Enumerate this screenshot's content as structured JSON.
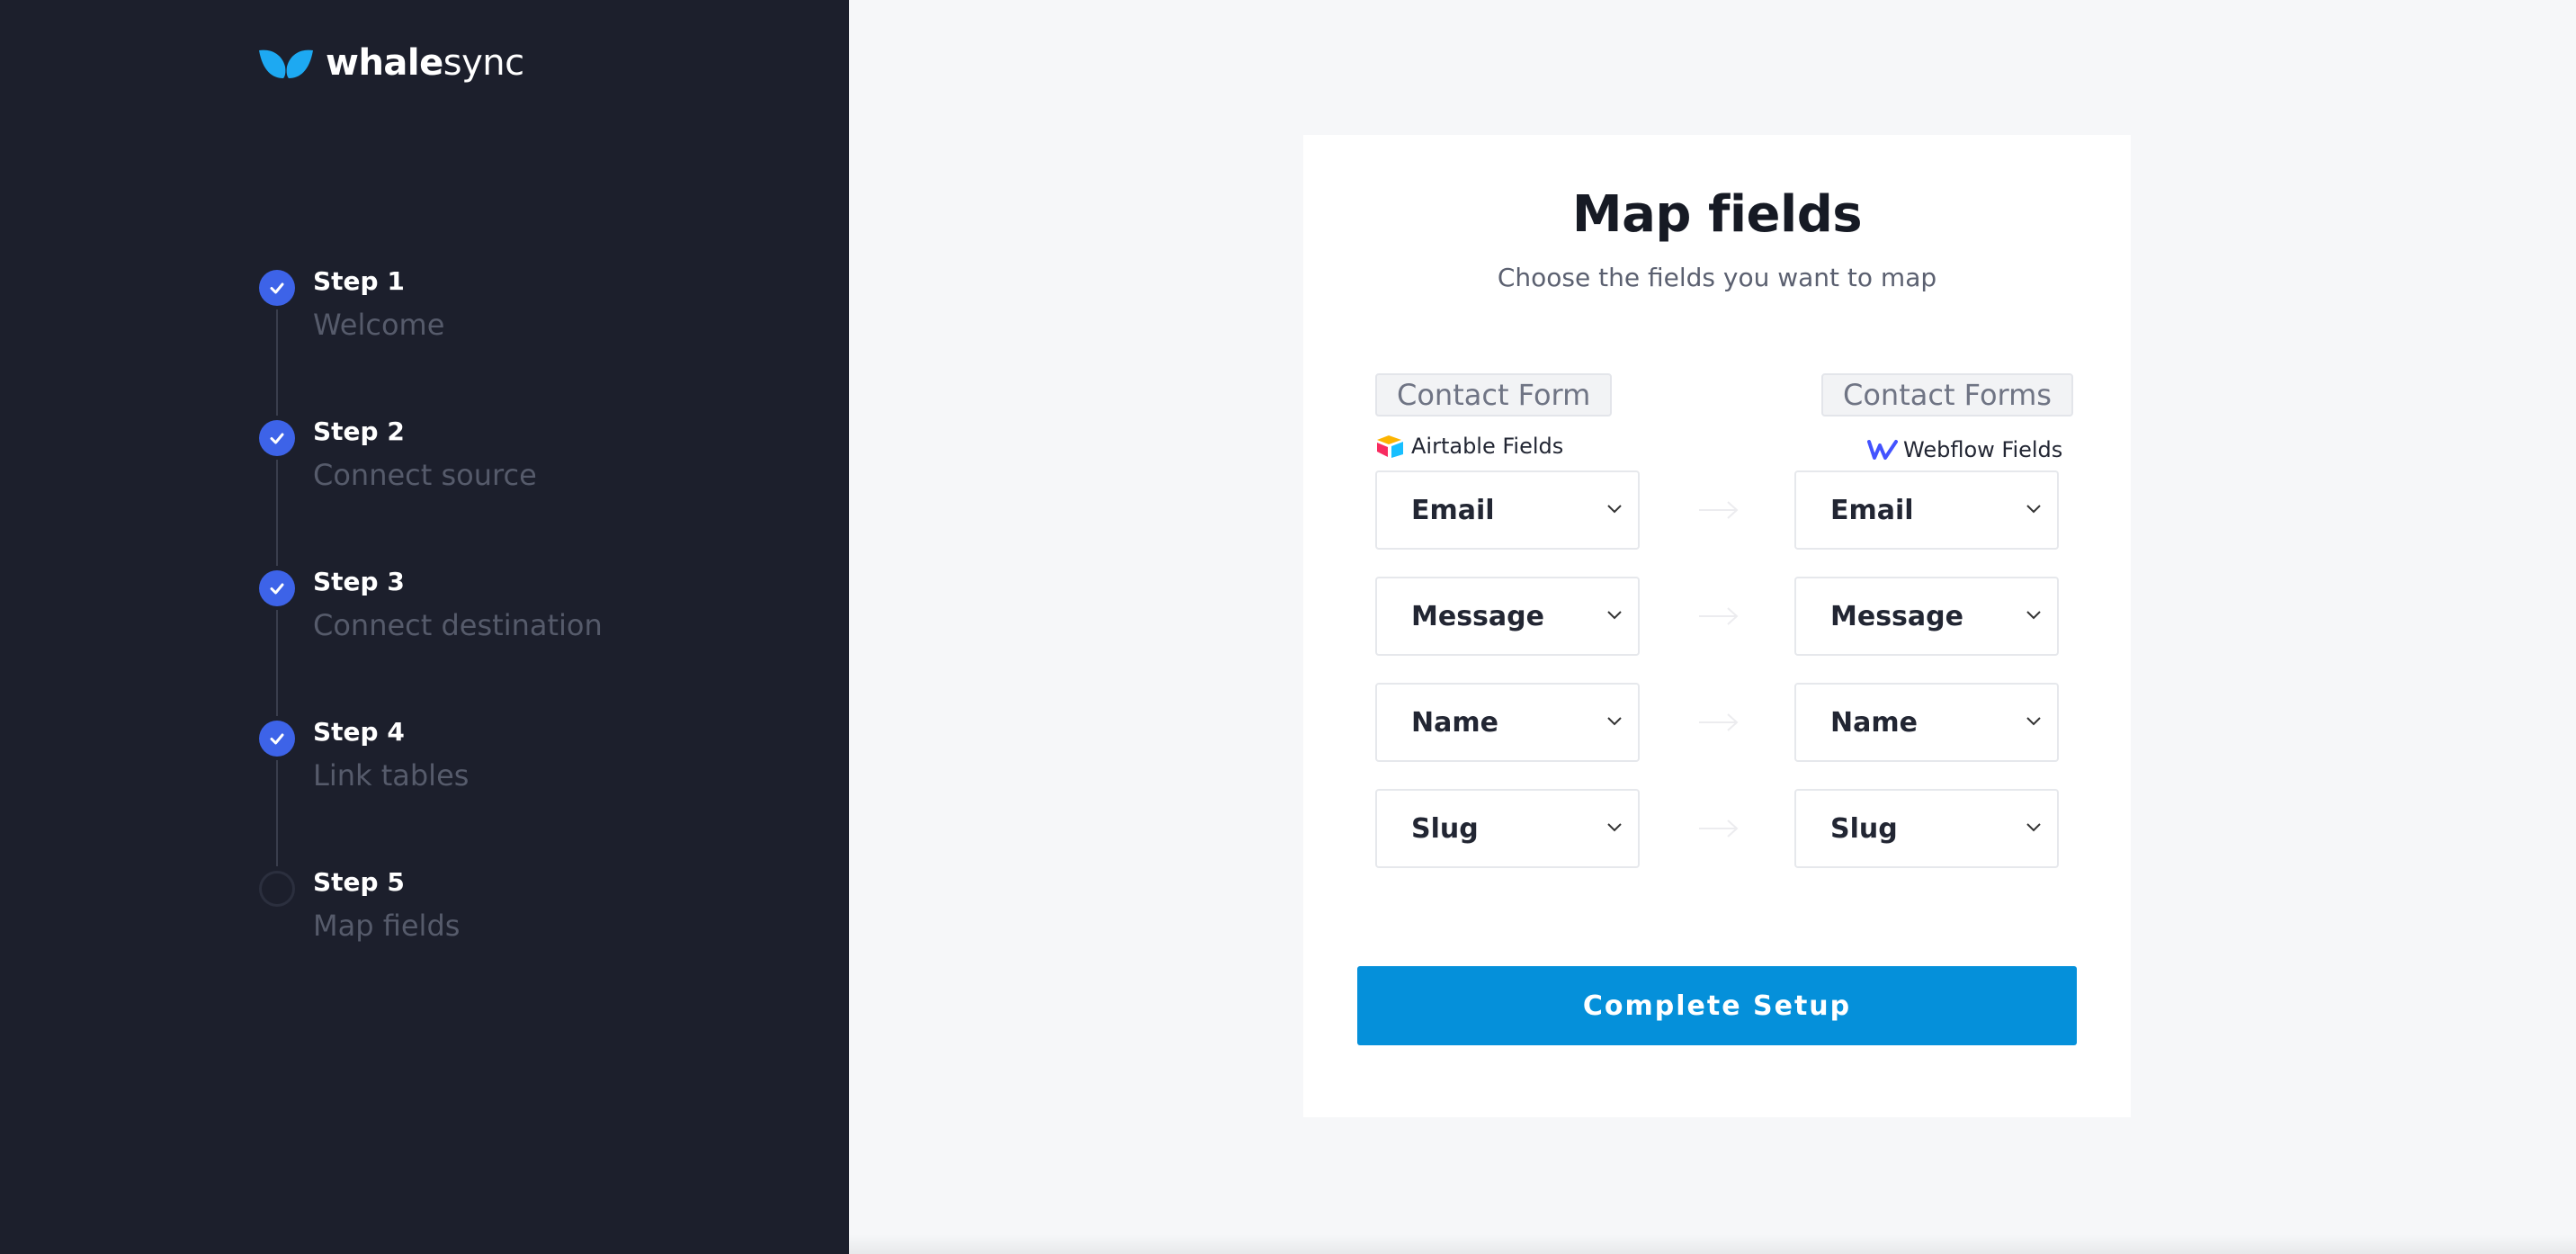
{
  "brand": {
    "name_bold": "whale",
    "name_light": "sync",
    "logo_icon": "whale-tail-icon",
    "accent": "#0590da"
  },
  "sidebar": {
    "steps": [
      {
        "title": "Step 1",
        "subtitle": "Welcome",
        "status": "done"
      },
      {
        "title": "Step 2",
        "subtitle": "Connect source",
        "status": "done"
      },
      {
        "title": "Step 3",
        "subtitle": "Connect destination",
        "status": "done"
      },
      {
        "title": "Step 4",
        "subtitle": "Link tables",
        "status": "done"
      },
      {
        "title": "Step 5",
        "subtitle": "Map fields",
        "status": "current"
      }
    ]
  },
  "main": {
    "title": "Map fields",
    "subtitle": "Choose the fields you want to map",
    "source_table": "Contact Form",
    "destination_table": "Contact Forms",
    "source_label": "Airtable Fields",
    "destination_label": "Webflow Fields",
    "mappings": [
      {
        "source": "Email",
        "destination": "Email"
      },
      {
        "source": "Message",
        "destination": "Message"
      },
      {
        "source": "Name",
        "destination": "Name"
      },
      {
        "source": "Slug",
        "destination": "Slug"
      }
    ],
    "complete_button": "Complete Setup"
  }
}
